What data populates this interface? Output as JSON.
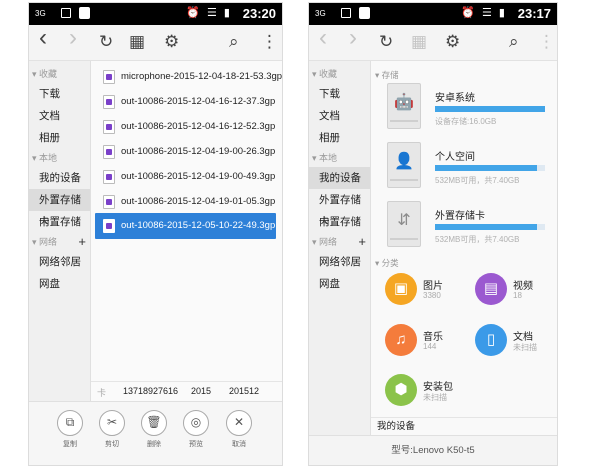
{
  "left": {
    "status": {
      "network": "3G",
      "time": "23:20",
      "icons": "⏰ ☰ ▮"
    },
    "toolbar": {
      "back": "‹",
      "forward": "›",
      "refresh": "↻",
      "view": "▦",
      "settings": "⚙",
      "search": "⌕",
      "more": "⋮"
    },
    "sidebar": {
      "favorites_header": "收藏",
      "favorites": [
        "下载",
        "文档",
        "相册"
      ],
      "local_header": "本地",
      "local": [
        "我的设备",
        "外置存储卡",
        "内置存储"
      ],
      "network_header": "网络",
      "network_plus": "+",
      "network": [
        "网络邻居",
        "网盘"
      ]
    },
    "files": [
      "microphone-2015-12-04-18-21-53.3gp",
      "out-10086-2015-12-04-16-12-37.3gp",
      "out-10086-2015-12-04-16-12-52.3gp",
      "out-10086-2015-12-04-19-00-26.3gp",
      "out-10086-2015-12-04-19-00-49.3gp",
      "out-10086-2015-12-04-19-01-05.3gp",
      "out-10086-2015-12-05-10-22-49.3gp"
    ],
    "bottom_bar": [
      "卡",
      "13718927616",
      "2015",
      "201512"
    ],
    "actions": [
      {
        "icon": "copy-icon",
        "glyph": "⧉",
        "label": "复制"
      },
      {
        "icon": "scissors-icon",
        "glyph": "✂",
        "label": "剪切"
      },
      {
        "icon": "trash-icon",
        "glyph": "🗑",
        "label": "删除"
      },
      {
        "icon": "preview-icon",
        "glyph": "◎",
        "label": "预览"
      },
      {
        "icon": "close-icon",
        "glyph": "✕",
        "label": "取消"
      }
    ]
  },
  "right": {
    "status": {
      "network": "3G",
      "time": "23:17",
      "icons": "⏰ ☰ ▮"
    },
    "toolbar": {
      "back": "‹",
      "forward": "›",
      "refresh": "↻",
      "view": "▦",
      "settings": "⚙",
      "search": "⌕",
      "more": "⋮"
    },
    "sidebar": {
      "favorites_header": "收藏",
      "favorites": [
        "下载",
        "文档",
        "相册"
      ],
      "local_header": "本地",
      "local": [
        "我的设备",
        "外置存储卡",
        "内置存储"
      ],
      "network_header": "网络",
      "network_plus": "+",
      "network": [
        "网络邻居",
        "网盘"
      ]
    },
    "storage_header": "存储",
    "storage": [
      {
        "name": "安卓系统",
        "caption": "设备存储:16.0GB",
        "usage": 1.0,
        "glyph": "🤖",
        "icon": "android-drive-icon"
      },
      {
        "name": "个人空间",
        "caption": "532MB可用，共7.40GB",
        "usage": 0.93,
        "glyph": "👤",
        "icon": "user-drive-icon"
      },
      {
        "name": "外置存储卡",
        "caption": "532MB可用，共7.40GB",
        "usage": 0.93,
        "glyph": "⇵",
        "icon": "usb-drive-icon"
      }
    ],
    "category_header": "分类",
    "categories": [
      {
        "name": "图片",
        "count": "3380",
        "color": "#f5a623",
        "glyph": "▣",
        "icon": "picture-icon"
      },
      {
        "name": "视频",
        "count": "18",
        "color": "#9b59d0",
        "glyph": "▤",
        "icon": "video-icon"
      },
      {
        "name": "音乐",
        "count": "144",
        "color": "#f47c3c",
        "glyph": "♫",
        "icon": "music-icon"
      },
      {
        "name": "文档",
        "count": "未扫描",
        "color": "#3b9ae8",
        "glyph": "▯",
        "icon": "document-icon"
      },
      {
        "name": "安装包",
        "count": "未扫描",
        "color": "#8bc34a",
        "glyph": "⬢",
        "icon": "apk-icon"
      }
    ],
    "path": "我的设备",
    "model": "型号:Lenovo K50-t5"
  }
}
